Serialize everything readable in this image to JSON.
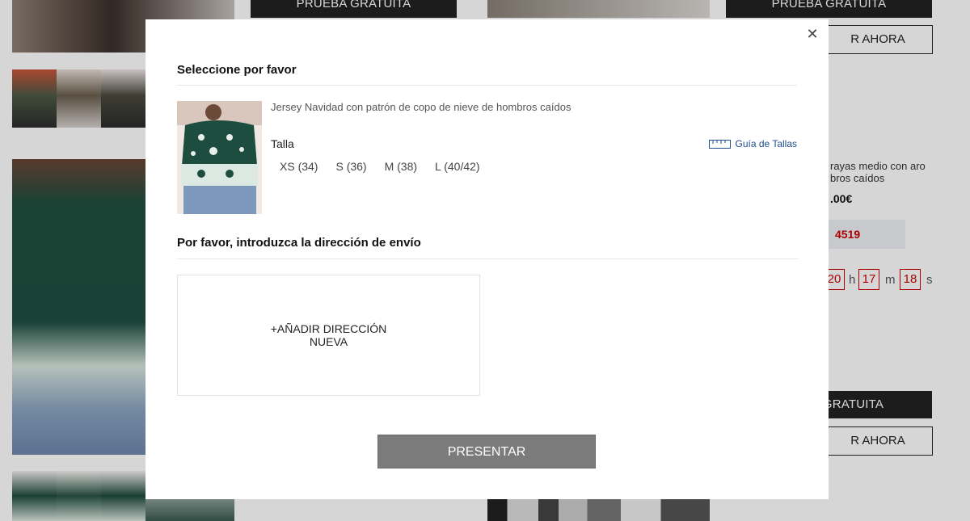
{
  "background": {
    "trial_label": "PRUEBA GRATUITA",
    "trial_label_partial": "GRATUITA",
    "buy_label_partial": "R AHORA",
    "desc_line1_partial": "rayas medio con aro",
    "desc_line2_partial": "bros caídos",
    "price_partial": ".00€",
    "code_partial": "4519",
    "timer": {
      "hours": "20",
      "hours_unit": "h",
      "minutes": "17",
      "minutes_unit": "m",
      "seconds": "18",
      "seconds_unit": "s"
    }
  },
  "modal": {
    "select_title": "Seleccione por favor",
    "product_name": "Jersey Navidad con patrón de copo de nieve de hombros caídos",
    "size_label": "Talla",
    "size_guide_label": "Guía de Tallas",
    "sizes": [
      "XS (34)",
      "S (36)",
      "M (38)",
      "L (40/42)"
    ],
    "shipping_title": "Por favor, introduzca la dirección de envío",
    "add_address_label": "+AÑADIR DIRECCIÓN NUEVA",
    "submit_label": "PRESENTAR",
    "close_icon": "close-icon"
  },
  "colors": {
    "accent_red": "#cc0000",
    "link_blue": "#1f4e8c",
    "submit_gray": "#7b7b7b",
    "dark_button": "#222222"
  }
}
